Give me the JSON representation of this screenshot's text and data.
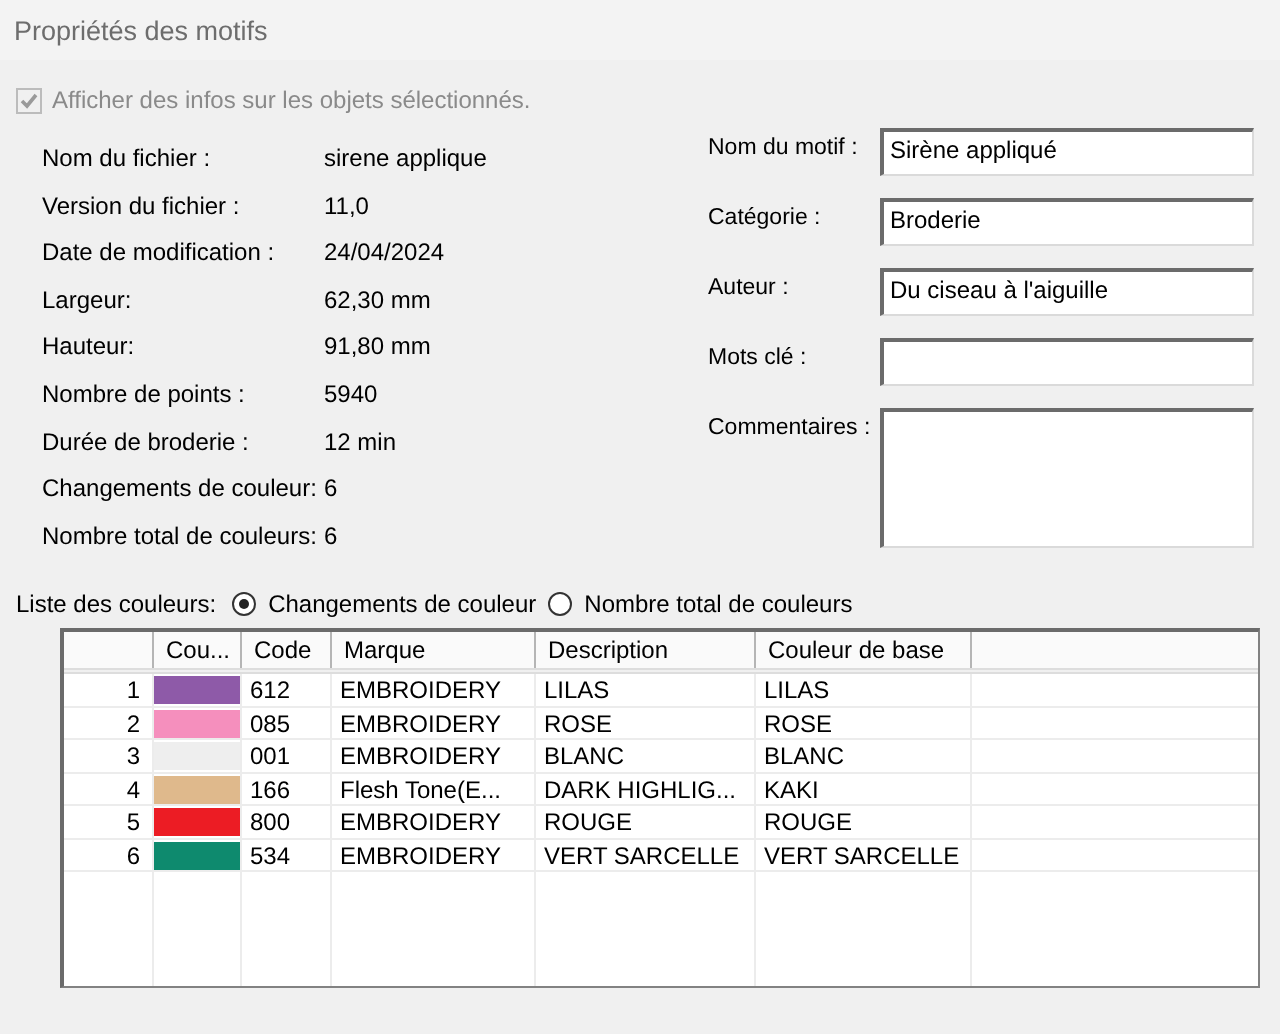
{
  "window": {
    "title": "Propriétés des motifs"
  },
  "show_info": {
    "label": "Afficher des infos sur les objets sélectionnés.",
    "checked": true,
    "disabled": true
  },
  "file_info": [
    {
      "label": "Nom du fichier :",
      "value": "sirene applique"
    },
    {
      "label": "Version du fichier :",
      "value": "11,0"
    },
    {
      "label": "Date de modification :",
      "value": "24/04/2024"
    },
    {
      "label": "Largeur:",
      "value": "62,30 mm"
    },
    {
      "label": "Hauteur:",
      "value": "91,80 mm"
    },
    {
      "label": "Nombre de points :",
      "value": "5940"
    },
    {
      "label": "Durée de broderie :",
      "value": "12 min"
    },
    {
      "label": "Changements de couleur:",
      "value": "6"
    },
    {
      "label": "Nombre total de couleurs:",
      "value": "6"
    }
  ],
  "fields": [
    {
      "label": "Nom du motif :",
      "value": "Sirène appliqué",
      "kind": "line"
    },
    {
      "label": "Catégorie :",
      "value": "Broderie",
      "kind": "line"
    },
    {
      "label": "Auteur :",
      "value": "Du ciseau à l'aiguille",
      "kind": "line"
    },
    {
      "label": "Mots clé :",
      "kind": "line"
    },
    {
      "label": "Commentaires :",
      "kind": "multiline"
    }
  ],
  "color_list": {
    "label": "Liste des couleurs:",
    "options": [
      {
        "label": "Changements de couleur",
        "selected": true
      },
      {
        "label": "Nombre total de couleurs",
        "selected": false
      }
    ],
    "table": {
      "columns": [
        "Cou...",
        "Code",
        "Marque",
        "Description",
        "Couleur de base"
      ],
      "rows": [
        {
          "number": "1",
          "color": "#8e5aa8",
          "code": "612",
          "brand": "EMBROIDERY",
          "description": "LILAS",
          "base_color": "LILAS"
        },
        {
          "number": "2",
          "color": "#f58fbd",
          "code": "085",
          "brand": "EMBROIDERY",
          "description": "ROSE",
          "base_color": "ROSE"
        },
        {
          "number": "3",
          "color": "#eeeeee",
          "code": "001",
          "brand": "EMBROIDERY",
          "description": "BLANC",
          "base_color": "BLANC"
        },
        {
          "number": "4",
          "color": "#dfb98c",
          "code": "166",
          "brand": "Flesh Tone(E...",
          "description": "DARK HIGHLIG...",
          "base_color": "KAKI"
        },
        {
          "number": "5",
          "color": "#ec1c24",
          "code": "800",
          "brand": "EMBROIDERY",
          "description": "ROUGE",
          "base_color": "ROUGE"
        },
        {
          "number": "6",
          "color": "#0e8a6e",
          "code": "534",
          "brand": "EMBROIDERY",
          "description": "VERT SARCELLE",
          "base_color": "VERT SARCELLE"
        }
      ]
    }
  }
}
